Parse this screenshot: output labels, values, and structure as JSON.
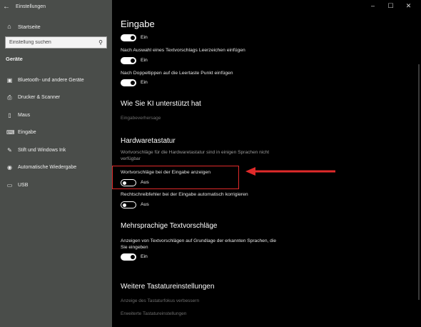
{
  "window": {
    "title": "Einstellungen",
    "controls": [
      "–",
      "☐",
      "✕"
    ]
  },
  "sidebar": {
    "home": "Startseite",
    "search_placeholder": "Einstellung suchen",
    "group": "Geräte",
    "items": [
      {
        "label": "Bluetooth- und andere Geräte",
        "icon": "bluetooth-icon"
      },
      {
        "label": "Drucker & Scanner",
        "icon": "printer-icon"
      },
      {
        "label": "Maus",
        "icon": "mouse-icon"
      },
      {
        "label": "Eingabe",
        "icon": "keyboard-icon"
      },
      {
        "label": "Stift und Windows Ink",
        "icon": "pen-icon"
      },
      {
        "label": "Automatische Wiedergabe",
        "icon": "autoplay-icon"
      },
      {
        "label": "USB",
        "icon": "usb-icon"
      }
    ]
  },
  "main": {
    "title": "Eingabe",
    "toggle1_state": "Ein",
    "opt_space": "Nach Auswahl eines Textvorschlags Leerzeichen einfügen",
    "opt_space_state": "Ein",
    "opt_period": "Nach Doppeltippen auf die Leertaste Punkt einfügen",
    "opt_period_state": "Ein",
    "ai_heading": "Wie Sie KI unterstützt hat",
    "ai_link": "Eingabeverhersage",
    "hw_heading": "Hardwaretastatur",
    "hw_hint": "Wortvorschläge für die Hardwaretastatur sind in einigen Sprachen nicht verfügbar",
    "hw_suggest": "Wortvorschläge bei der Eingabe anzeigen",
    "hw_suggest_state": "Aus",
    "hw_autocorrect": "Rechtschreibfehler bei der Eingabe automatisch korrigieren",
    "hw_autocorrect_state": "Aus",
    "multi_heading": "Mehrsprachige Textvorschläge",
    "multi_desc": "Anzeigen von Textvorschlägen auf Grundlage der erkannten Sprachen, die Sie eingeben",
    "multi_state": "Ein",
    "more_heading": "Weitere Tastatureinstellungen",
    "more_link1": "Anzeige des Tastaturfokus verbessern",
    "more_link2": "Erweiterte Tastatureinstellungen"
  },
  "colors": {
    "sidebar_bg": "#4a4d4a",
    "content_bg": "#000000",
    "annotation": "#e02a2a"
  }
}
